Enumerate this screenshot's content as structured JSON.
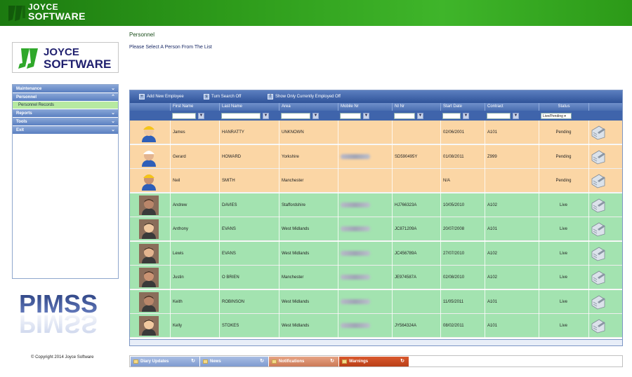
{
  "banner": {
    "brand_line1": "JOYCE",
    "brand_line2": "SOFTWARE"
  },
  "sidebar": {
    "logo_line1": "JOYCE",
    "logo_line2": "SOFTWARE",
    "menu": [
      {
        "label": "Maintenance",
        "icon": "chevron-down-icon"
      },
      {
        "label": "Personnel",
        "icon": "chevron-up-icon"
      },
      {
        "label": "Personnel Records",
        "sub": true
      },
      {
        "label": "Reports",
        "icon": "chevron-down-icon"
      },
      {
        "label": "Tools",
        "icon": "chevron-down-icon"
      },
      {
        "label": "Exit",
        "icon": "chevron-down-icon"
      }
    ],
    "pimss_logo": "PIMSS",
    "copyright": "© Copyright 2014 Joyce Software"
  },
  "page": {
    "title": "Personnel",
    "subtitle": "Please Select A Person From The List"
  },
  "grid": {
    "toolbar": {
      "add": "Add New Employee",
      "search": "Turn Search Off",
      "employed": "Show Only Currently Employed Off"
    },
    "columns": [
      "First Name",
      "Last Name",
      "Area",
      "Mobile Nr",
      "NI Nr",
      "Start Date",
      "Contract",
      "Status"
    ],
    "status_filter": "Live/Pending",
    "rows": [
      {
        "first": "James",
        "last": "HANRATTY",
        "area": "UNKNOWN",
        "ni": "",
        "start": "02/06/2001",
        "contract": "A101",
        "status": "Pending",
        "mobile_blur": false
      },
      {
        "first": "Gerard",
        "last": "HOWARD",
        "area": "Yorkshire",
        "ni": "SD590495Y",
        "start": "01/08/2011",
        "contract": "Z999",
        "status": "Pending",
        "mobile_blur": true
      },
      {
        "first": "Neil",
        "last": "SMITH",
        "area": "Manchester",
        "ni": "",
        "start": "N/A",
        "contract": "",
        "status": "Pending",
        "mobile_blur": false
      },
      {
        "first": "Andrew",
        "last": "DAVIES",
        "area": "Staffordshire",
        "ni": "HJ766323A",
        "start": "10/05/2010",
        "contract": "A102",
        "status": "Live",
        "mobile_blur": true
      },
      {
        "first": "Anthony",
        "last": "EVANS",
        "area": "West Midlands",
        "ni": "JC871209A",
        "start": "20/07/2008",
        "contract": "A101",
        "status": "Live",
        "mobile_blur": true
      },
      {
        "first": "Lewis",
        "last": "EVANS",
        "area": "West Midlands",
        "ni": "JC456789A",
        "start": "27/07/2010",
        "contract": "A102",
        "status": "Live",
        "mobile_blur": true
      },
      {
        "first": "Justin",
        "last": "O BRIEN",
        "area": "Manchester",
        "ni": "JE974587A",
        "start": "02/08/2010",
        "contract": "A102",
        "status": "Live",
        "mobile_blur": true
      },
      {
        "first": "Keith",
        "last": "ROBINSON",
        "area": "West Midlands",
        "ni": "",
        "start": "11/05/2011",
        "contract": "A101",
        "status": "Live",
        "mobile_blur": true
      },
      {
        "first": "Kelly",
        "last": "STOKES",
        "area": "West Midlands",
        "ni": "JY564324A",
        "start": "08/02/2011",
        "contract": "A101",
        "status": "Live",
        "mobile_blur": true
      }
    ]
  },
  "tabs": [
    {
      "label": "Diary Updates",
      "color": "#8fa9d8"
    },
    {
      "label": "News",
      "color": "#8fa9d8"
    },
    {
      "label": "Notifications",
      "color": "#d98a6a"
    },
    {
      "label": "Warnings",
      "color": "#c8461f"
    }
  ],
  "colors": {
    "banner_green": "#2d9a1a",
    "pending_row": "#fbd6a5",
    "live_row": "#a3e3b0",
    "grid_blue": "#3f64ab"
  }
}
